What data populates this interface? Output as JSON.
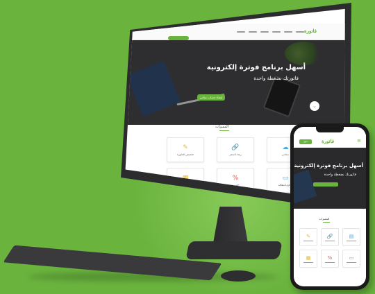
{
  "colors": {
    "background": "#6ab43e",
    "accent": "#6ab43e",
    "dark_hero": "#3e3e40"
  },
  "desktop": {
    "logo": "فاتورة",
    "nav_links": 6,
    "hero": {
      "title": "أسهل برنامج فوترة إلكترونية",
      "subtitle": "فاتورتك بضغطة واحدة",
      "cta": "إنشاء حساب مجاني"
    },
    "features_title": "المميزات",
    "features": [
      {
        "icon": "cloud-icon",
        "glyph": "☁",
        "label": "سحابي"
      },
      {
        "icon": "link-icon",
        "glyph": "🔗",
        "label": "ربط بالمتجر"
      },
      {
        "icon": "pencil-icon",
        "glyph": "✎",
        "label": "تخصيص الفاتورة"
      },
      {
        "icon": "card-icon",
        "glyph": "▭",
        "label": "الدفع بالبطاقة"
      },
      {
        "icon": "percent-icon",
        "glyph": "%",
        "label": "الضريبة"
      },
      {
        "icon": "chart-icon",
        "glyph": "▦",
        "label": "تقارير"
      }
    ]
  },
  "mobile": {
    "logo": "فاتورة",
    "header_button": "دخول",
    "hero": {
      "title": "أسهل برنامج فوترة إلكترونية",
      "subtitle": "فاتورتك بضغطة واحدة"
    },
    "features_title": "المميزات",
    "features": [
      {
        "icon": "doc-icon",
        "glyph": "▤"
      },
      {
        "icon": "link-icon",
        "glyph": "🔗"
      },
      {
        "icon": "pencil-icon",
        "glyph": "✎"
      },
      {
        "icon": "card-icon",
        "glyph": "▭"
      },
      {
        "icon": "percent-icon",
        "glyph": "%"
      },
      {
        "icon": "chart-icon",
        "glyph": "▦"
      }
    ]
  }
}
